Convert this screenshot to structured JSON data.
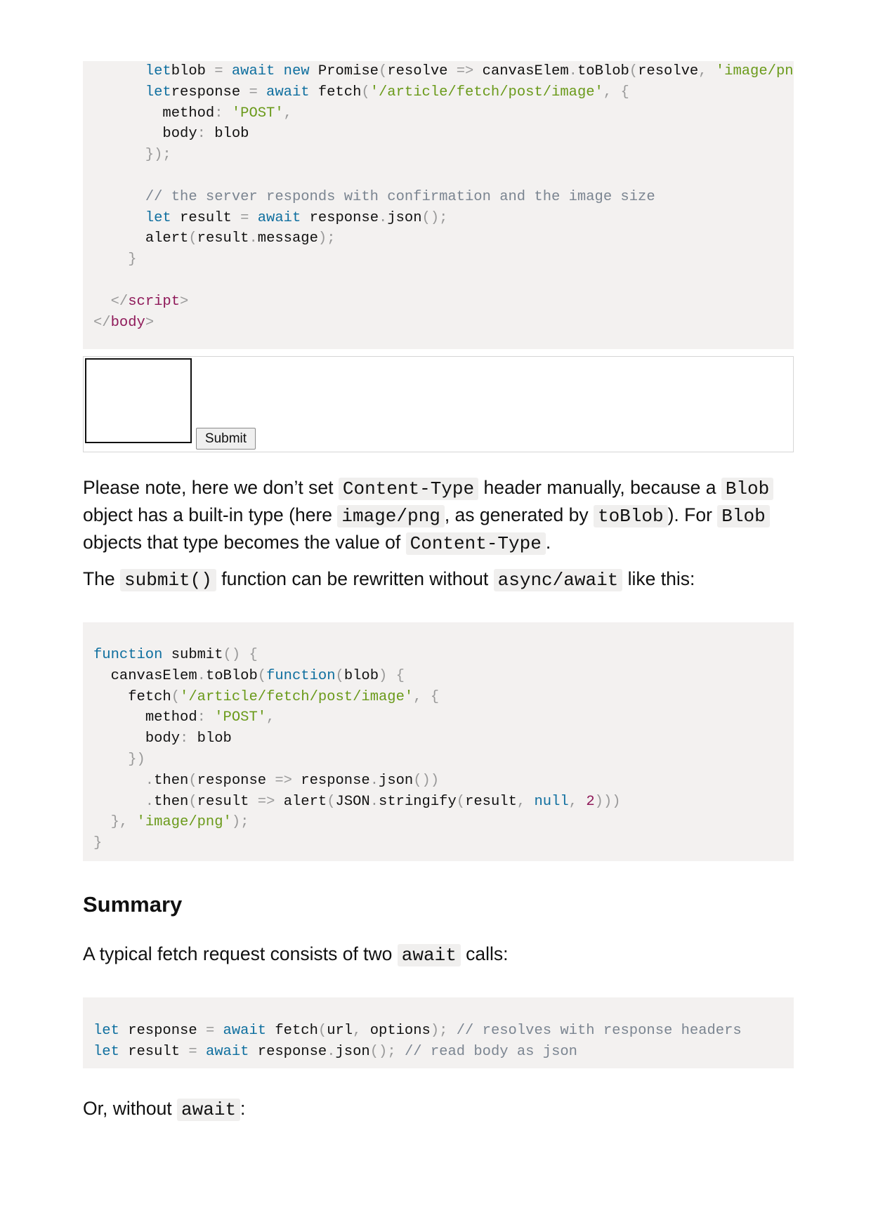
{
  "code_block_1": {
    "lines": [
      [
        [
          "pn",
          "      "
        ],
        [
          "kw",
          "let"
        ],
        [
          "",
          "blob "
        ],
        [
          "pn",
          "="
        ],
        [
          "kw",
          " await new "
        ],
        [
          "",
          "Promise"
        ],
        [
          "pn",
          "("
        ],
        [
          "",
          "resolve "
        ],
        [
          "pn",
          "=>"
        ],
        [
          "",
          " canvasElem"
        ],
        [
          "pn",
          "."
        ],
        [
          "",
          "toBlob"
        ],
        [
          "pn",
          "("
        ],
        [
          "",
          "resolve"
        ],
        [
          "pn",
          ", "
        ],
        [
          "str",
          "'image/png"
        ]
      ],
      [
        [
          "pn",
          "      "
        ],
        [
          "kw",
          "let"
        ],
        [
          "",
          "response "
        ],
        [
          "pn",
          "="
        ],
        [
          "kw",
          " await "
        ],
        [
          "",
          "fetch"
        ],
        [
          "pn",
          "("
        ],
        [
          "str",
          "'/article/fetch/post/image'"
        ],
        [
          "pn",
          ", {"
        ]
      ],
      [
        [
          "pn",
          "        "
        ],
        [
          "",
          "method"
        ],
        [
          "pn",
          ": "
        ],
        [
          "str",
          "'POST'"
        ],
        [
          "pn",
          ","
        ]
      ],
      [
        [
          "pn",
          "        "
        ],
        [
          "",
          "body"
        ],
        [
          "pn",
          ": "
        ],
        [
          "",
          "blob"
        ]
      ],
      [
        [
          "pn",
          "      });"
        ]
      ],
      [
        [
          "",
          ""
        ]
      ],
      [
        [
          "pn",
          "      "
        ],
        [
          "cm",
          "// the server responds with confirmation and the image size"
        ]
      ],
      [
        [
          "pn",
          "      "
        ],
        [
          "kw",
          "let"
        ],
        [
          "",
          " result "
        ],
        [
          "pn",
          "="
        ],
        [
          "kw",
          " await "
        ],
        [
          "",
          "response"
        ],
        [
          "pn",
          "."
        ],
        [
          "",
          "json"
        ],
        [
          "pn",
          "();"
        ]
      ],
      [
        [
          "pn",
          "      "
        ],
        [
          "",
          "alert"
        ],
        [
          "pn",
          "("
        ],
        [
          "",
          "result"
        ],
        [
          "pn",
          "."
        ],
        [
          "",
          "message"
        ],
        [
          "pn",
          ");"
        ]
      ],
      [
        [
          "pn",
          "    }"
        ]
      ],
      [
        [
          "",
          ""
        ]
      ],
      [
        [
          "pn",
          "  </"
        ],
        [
          "tag",
          "script"
        ],
        [
          "pn",
          ">"
        ]
      ],
      [
        [
          "pn",
          "</"
        ],
        [
          "tag",
          "body"
        ],
        [
          "pn",
          ">"
        ]
      ]
    ]
  },
  "demo": {
    "submit_label": "Submit"
  },
  "para1": {
    "t1": "Please note, here we don’t set ",
    "c1": "Content-Type",
    "t2": " header manually, because a ",
    "c2": "Blob",
    "t3": " object has a built-in type (here ",
    "c3": "image/png",
    "t4": ", as generated by ",
    "c4": "toBlob",
    "t5": "). For ",
    "c5": "Blob",
    "t6": " objects that type becomes the value of ",
    "c6": "Content-Type",
    "t7": "."
  },
  "para2": {
    "t1": "The ",
    "c1": "submit()",
    "t2": " function can be rewritten without ",
    "c2": "async/await",
    "t3": " like this:"
  },
  "code_block_2": {
    "lines": [
      [
        [
          "kw",
          "function"
        ],
        [
          "",
          " submit"
        ],
        [
          "pn",
          "() {"
        ]
      ],
      [
        [
          "pn",
          "  "
        ],
        [
          "",
          "canvasElem"
        ],
        [
          "pn",
          "."
        ],
        [
          "",
          "toBlob"
        ],
        [
          "pn",
          "("
        ],
        [
          "kw",
          "function"
        ],
        [
          "pn",
          "("
        ],
        [
          "",
          "blob"
        ],
        [
          "pn",
          ") {"
        ]
      ],
      [
        [
          "pn",
          "    "
        ],
        [
          "",
          "fetch"
        ],
        [
          "pn",
          "("
        ],
        [
          "str",
          "'/article/fetch/post/image'"
        ],
        [
          "pn",
          ", {"
        ]
      ],
      [
        [
          "pn",
          "      "
        ],
        [
          "",
          "method"
        ],
        [
          "pn",
          ": "
        ],
        [
          "str",
          "'POST'"
        ],
        [
          "pn",
          ","
        ]
      ],
      [
        [
          "pn",
          "      "
        ],
        [
          "",
          "body"
        ],
        [
          "pn",
          ": "
        ],
        [
          "",
          "blob"
        ]
      ],
      [
        [
          "pn",
          "    })"
        ]
      ],
      [
        [
          "pn",
          "      ."
        ],
        [
          "",
          "then"
        ],
        [
          "pn",
          "("
        ],
        [
          "",
          "response "
        ],
        [
          "pn",
          "=>"
        ],
        [
          "",
          " response"
        ],
        [
          "pn",
          "."
        ],
        [
          "",
          "json"
        ],
        [
          "pn",
          "())"
        ]
      ],
      [
        [
          "pn",
          "      ."
        ],
        [
          "",
          "then"
        ],
        [
          "pn",
          "("
        ],
        [
          "",
          "result "
        ],
        [
          "pn",
          "=>"
        ],
        [
          "",
          " alert"
        ],
        [
          "pn",
          "("
        ],
        [
          "",
          "JSON"
        ],
        [
          "pn",
          "."
        ],
        [
          "",
          "stringify"
        ],
        [
          "pn",
          "("
        ],
        [
          "",
          "result"
        ],
        [
          "pn",
          ", "
        ],
        [
          "kw",
          "null"
        ],
        [
          "pn",
          ", "
        ],
        [
          "num",
          "2"
        ],
        [
          "pn",
          ")))"
        ]
      ],
      [
        [
          "pn",
          "  }, "
        ],
        [
          "str",
          "'image/png'"
        ],
        [
          "pn",
          ");"
        ]
      ],
      [
        [
          "pn",
          "}"
        ]
      ]
    ]
  },
  "summary": {
    "heading": "Summary",
    "t1": "A typical fetch request consists of two ",
    "c1": "await",
    "t2": " calls:"
  },
  "code_block_3": {
    "lines": [
      [
        [
          "kw",
          "let"
        ],
        [
          "",
          " response "
        ],
        [
          "pn",
          "="
        ],
        [
          "kw",
          " await "
        ],
        [
          "",
          "fetch"
        ],
        [
          "pn",
          "("
        ],
        [
          "",
          "url"
        ],
        [
          "pn",
          ", "
        ],
        [
          "",
          "options"
        ],
        [
          "pn",
          "); "
        ],
        [
          "cm",
          "// resolves with response headers"
        ]
      ],
      [
        [
          "kw",
          "let"
        ],
        [
          "",
          " result "
        ],
        [
          "pn",
          "="
        ],
        [
          "kw",
          " await "
        ],
        [
          "",
          "response"
        ],
        [
          "pn",
          "."
        ],
        [
          "",
          "json"
        ],
        [
          "pn",
          "(); "
        ],
        [
          "cm",
          "// read body as json"
        ]
      ]
    ]
  },
  "para4": {
    "t1": "Or, without ",
    "c1": "await",
    "t2": ":"
  }
}
